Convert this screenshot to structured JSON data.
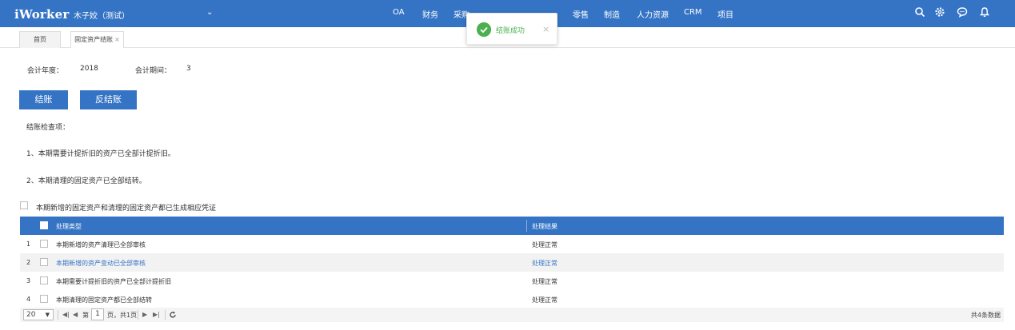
{
  "header": {
    "brand": "iWorker",
    "company": "木子姣（测试）",
    "nav": [
      "OA",
      "财务",
      "采购",
      "零售",
      "制造",
      "人力资源",
      "CRM",
      "项目"
    ],
    "icons": [
      "search-icon",
      "gear-icon",
      "chat-icon",
      "bell-icon"
    ]
  },
  "tabs": [
    {
      "label": "首页",
      "active": false
    },
    {
      "label": "固定资产结账",
      "close": "×",
      "active": true
    }
  ],
  "toast": {
    "message": "结账成功",
    "close": "×"
  },
  "period": {
    "year_label": "会计年度：",
    "year_value": "2018",
    "period_label": "会计期间：",
    "period_value": "3"
  },
  "buttons": {
    "close_label": "结账",
    "reverse_label": "反结账"
  },
  "check": {
    "title": "结账检查项：",
    "item1": "1、本期需要计提折旧的资产已全部计提折旧。",
    "item2": "2、本期清理的固定资产已全部结转。",
    "voucher_label": "本期新增的固定资产和清理的固定资产都已生成相应凭证"
  },
  "grid": {
    "columns": [
      "处理类型",
      "处理结果"
    ],
    "rows": [
      {
        "num": "1",
        "type": "本期新增的资产清理已全部审核",
        "result": "处理正常"
      },
      {
        "num": "2",
        "type": "本期新增的资产变动已全部审核",
        "result": "处理正常"
      },
      {
        "num": "3",
        "type": "本期需要计提折旧的资产已全部计提折旧",
        "result": "处理正常"
      },
      {
        "num": "4",
        "type": "本期清理的固定资产都已全部结转",
        "result": "处理正常"
      }
    ]
  },
  "pager": {
    "page_size": "20",
    "page_prefix": "第",
    "page_value": "1",
    "page_suffix": "页，共1页",
    "total": "共4条数据"
  },
  "colors": {
    "primary": "#3574c4",
    "success": "#4caf50"
  }
}
